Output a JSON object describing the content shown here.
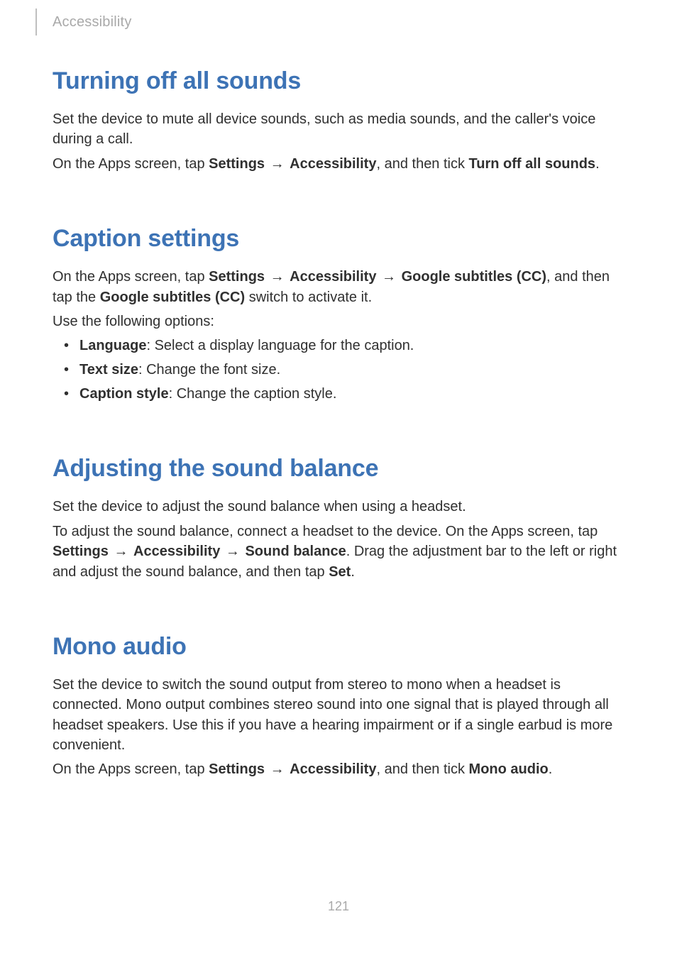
{
  "header": {
    "breadcrumb": "Accessibility"
  },
  "section1": {
    "title": "Turning off all sounds",
    "para1": "Set the device to mute all device sounds, such as media sounds, and the caller's voice during a call.",
    "para2_prefix": "On the Apps screen, tap ",
    "para2_b1": "Settings",
    "arrow": "→",
    "para2_b2": "Accessibility",
    "para2_mid": ", and then tick ",
    "para2_b3": "Turn off all sounds",
    "para2_suffix": "."
  },
  "section2": {
    "title": "Caption settings",
    "para1_prefix": "On the Apps screen, tap ",
    "para1_b1": "Settings",
    "arrow": "→",
    "para1_b2": "Accessibility",
    "para1_b3": "Google subtitles (CC)",
    "para1_mid": ", and then tap the ",
    "para1_b4": "Google subtitles (CC)",
    "para1_suffix": " switch to activate it.",
    "para2": "Use the following options:",
    "options": [
      {
        "label": "Language",
        "desc": ": Select a display language for the caption."
      },
      {
        "label": "Text size",
        "desc": ": Change the font size."
      },
      {
        "label": "Caption style",
        "desc": ": Change the caption style."
      }
    ]
  },
  "section3": {
    "title": "Adjusting the sound balance",
    "para1": "Set the device to adjust the sound balance when using a headset.",
    "para2_prefix": "To adjust the sound balance, connect a headset to the device. On the Apps screen, tap ",
    "para2_b1": "Settings",
    "arrow": "→",
    "para2_b2": "Accessibility",
    "para2_b3": "Sound balance",
    "para2_mid": ". Drag the adjustment bar to the left or right and adjust the sound balance, and then tap ",
    "para2_b4": "Set",
    "para2_suffix": "."
  },
  "section4": {
    "title": "Mono audio",
    "para1": "Set the device to switch the sound output from stereo to mono when a headset is connected. Mono output combines stereo sound into one signal that is played through all headset speakers. Use this if you have a hearing impairment or if a single earbud is more convenient.",
    "para2_prefix": "On the Apps screen, tap ",
    "para2_b1": "Settings",
    "arrow": "→",
    "para2_b2": "Accessibility",
    "para2_mid": ", and then tick ",
    "para2_b3": "Mono audio",
    "para2_suffix": "."
  },
  "pageNumber": "121"
}
